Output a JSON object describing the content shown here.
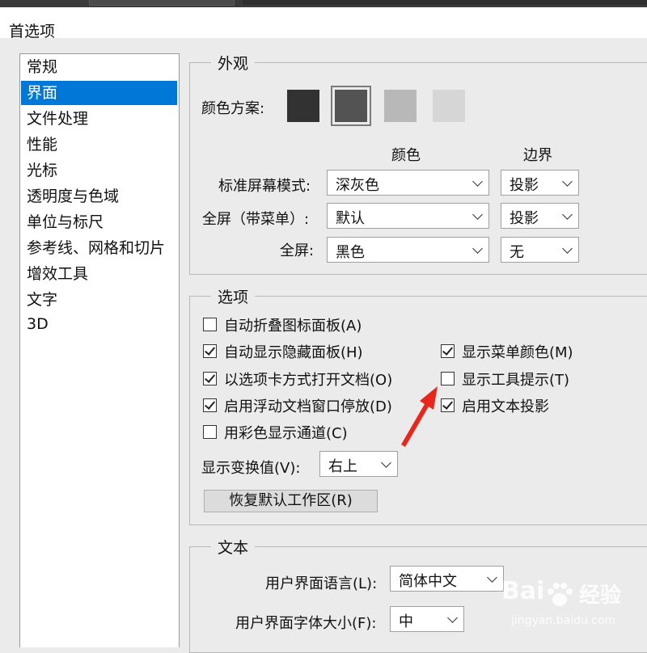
{
  "window": {
    "title": "首选项"
  },
  "sidebar": {
    "items": [
      {
        "label": "常规"
      },
      {
        "label": "界面",
        "selected": true
      },
      {
        "label": "文件处理"
      },
      {
        "label": "性能"
      },
      {
        "label": "光标"
      },
      {
        "label": "透明度与色域"
      },
      {
        "label": "单位与标尺"
      },
      {
        "label": "参考线、网格和切片"
      },
      {
        "label": "增效工具"
      },
      {
        "label": "文字"
      },
      {
        "label": "3D"
      }
    ]
  },
  "appearance": {
    "legend": "外观",
    "color_scheme_label": "颜色方案:",
    "color_schemes": [
      "#323232",
      "#535353",
      "#b8b8b8",
      "#d6d6d6"
    ],
    "selected_scheme_index": 1,
    "header_color": "颜色",
    "header_border": "边界",
    "rows": [
      {
        "label": "标准屏幕模式:",
        "color": "深灰色",
        "border": "投影"
      },
      {
        "label": "全屏（带菜单）:",
        "color": "默认",
        "border": "投影"
      },
      {
        "label": "全屏:",
        "color": "黑色",
        "border": "无"
      }
    ]
  },
  "options": {
    "legend": "选项",
    "checkboxes_left": [
      {
        "label": "自动折叠图标面板(A)",
        "checked": false
      },
      {
        "label": "自动显示隐藏面板(H)",
        "checked": true
      },
      {
        "label": "以选项卡方式打开文档(O)",
        "checked": true
      },
      {
        "label": "启用浮动文档窗口停放(D)",
        "checked": true
      },
      {
        "label": "用彩色显示通道(C)",
        "checked": false
      }
    ],
    "checkboxes_right": [
      {
        "label": "显示菜单颜色(M)",
        "checked": true
      },
      {
        "label": "显示工具提示(T)",
        "checked": false
      },
      {
        "label": "启用文本投影",
        "checked": true
      }
    ],
    "transform_label": "显示变换值(V):",
    "transform_value": "右上",
    "reset_button": "恢复默认工作区(R)"
  },
  "text": {
    "legend": "文本",
    "ui_language_label": "用户界面语言(L):",
    "ui_language_value": "简体中文",
    "ui_font_size_label": "用户界面字体大小(F):",
    "ui_font_size_value": "中"
  },
  "annotation": {
    "arrow_color": "#e8261c"
  },
  "watermark": {
    "brand": "Bai",
    "brand2": "经验",
    "url": "jingyan.baidu.com"
  }
}
